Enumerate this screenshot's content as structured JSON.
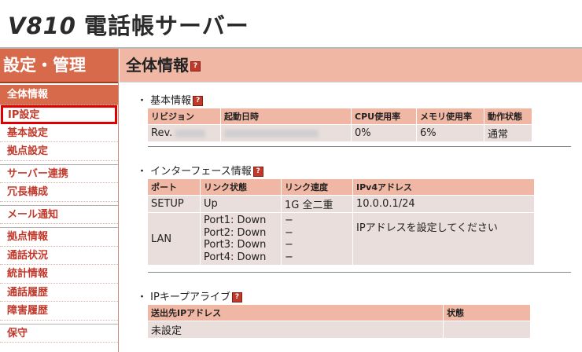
{
  "header": {
    "model": "V810",
    "title": "電話帳サーバー"
  },
  "sidebar": {
    "heading": "設定・管理",
    "items": [
      {
        "label": "全体情報"
      },
      {
        "label": "IP設定"
      },
      {
        "label": "基本設定"
      },
      {
        "label": "拠点設定"
      },
      {
        "label": "サーバー連携"
      },
      {
        "label": "冗長構成"
      },
      {
        "label": "メール通知"
      },
      {
        "label": "拠点情報"
      },
      {
        "label": "通話状況"
      },
      {
        "label": "統計情報"
      },
      {
        "label": "通話履歴"
      },
      {
        "label": "障害履歴"
      },
      {
        "label": "保守"
      }
    ]
  },
  "main": {
    "page_title": "全体情報",
    "help_glyph": "?",
    "basic": {
      "title": "基本情報",
      "headers": [
        "リビジョン",
        "起動日時",
        "CPU使用率",
        "メモリ使用率",
        "動作状態"
      ],
      "row": {
        "revision": "Rev.",
        "cpu": "0%",
        "memory": "6%",
        "status": "通常"
      }
    },
    "interface": {
      "title": "インターフェース情報",
      "headers": [
        "ポート",
        "リンク状態",
        "リンク速度",
        "IPv4アドレス"
      ],
      "setup": {
        "port": "SETUP",
        "link": "Up",
        "speed": "1G 全二重",
        "ipv4": "10.0.0.1/24"
      },
      "lan": {
        "port": "LAN",
        "links": [
          "Port1: Down",
          "Port2: Down",
          "Port3: Down",
          "Port4: Down"
        ],
        "speeds": [
          "−",
          "−",
          "−",
          "−"
        ],
        "ipv4": "IPアドレスを設定してください"
      }
    },
    "keepalive": {
      "title": "IPキープアライブ",
      "headers": [
        "送出先IPアドレス",
        "状態"
      ],
      "row": {
        "dest": "未設定",
        "status": ""
      }
    }
  },
  "colors": {
    "accent": "#d86a4c",
    "header_light": "#f0b7a4",
    "cell": "#e9dedc",
    "link": "#1a3fb3",
    "error": "#d03020"
  }
}
